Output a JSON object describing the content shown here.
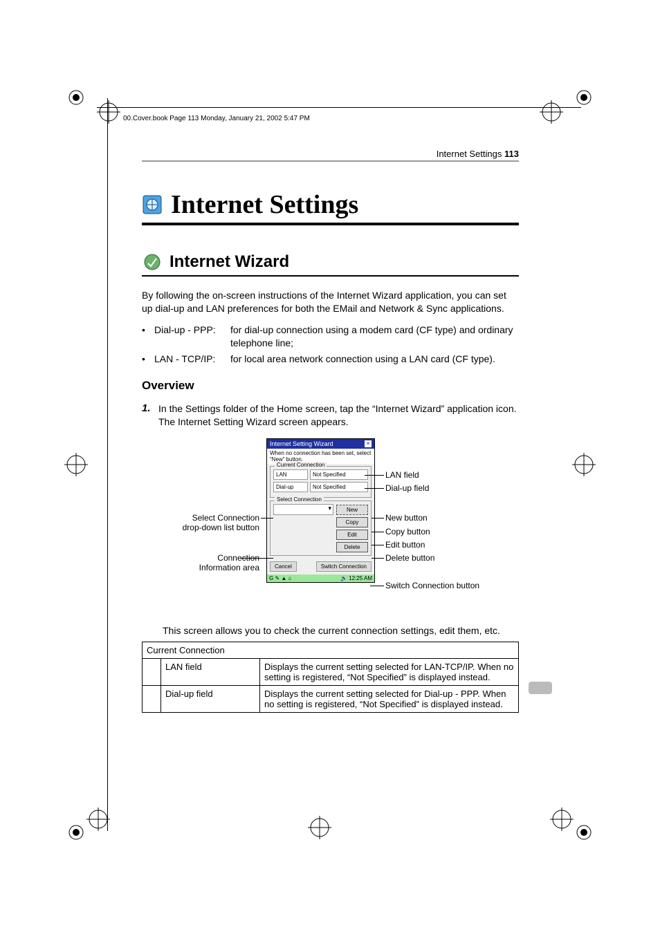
{
  "header_note": "00.Cover.book  Page 113  Monday, January 21, 2002  5:47 PM",
  "running": {
    "section": "Internet Settings",
    "page": "113"
  },
  "chapter_title": "Internet Settings",
  "section_title": "Internet Wizard",
  "intro": "By following the on-screen instructions of the Internet Wizard application, you can set up dial-up and LAN preferences for both the EMail and Network & Sync applications.",
  "bullets": [
    {
      "label": "Dial-up - PPP:",
      "desc": "for dial-up connection using a modem card (CF type) and ordinary telephone line;"
    },
    {
      "label": "LAN - TCP/IP:",
      "desc": "for local area network connection using a LAN card (CF type)."
    }
  ],
  "subhead": "Overview",
  "step1_num": "1.",
  "step1_a": "In the Settings folder of the Home screen, tap the “Internet Wizard” application icon.",
  "step1_b": "The Internet Setting Wizard screen appears.",
  "device": {
    "title": "Internet Setting Wizard",
    "tip": "When no connection has been set, select “New” button.",
    "legend_current": "Current Connection",
    "lan_label": "LAN",
    "lan_value": "Not Specified",
    "dialup_label": "Dial-up",
    "dialup_value": "Not Specified",
    "legend_select": "Select Connection",
    "btn_new": "New",
    "btn_copy": "Copy",
    "btn_edit": "Edit",
    "btn_delete": "Delete",
    "btn_cancel": "Cancel",
    "btn_switch": "Switch Connection",
    "task_time": "12:25 AM"
  },
  "callouts": {
    "left1": "Select Connection drop-down list button",
    "left2": "Connection Information area",
    "r_lan": "LAN field",
    "r_dialup": "Dial-up field",
    "r_new": "New button",
    "r_copy": "Copy button",
    "r_edit": "Edit button",
    "r_delete": "Delete button",
    "r_switch": "Switch Connection button"
  },
  "after_fig": "This screen allows you to check the current connection settings, edit them, etc.",
  "table": {
    "head": "Current Connection",
    "rows": [
      {
        "label": "LAN field",
        "desc": "Displays the current setting selected for LAN-TCP/IP. When no setting is registered, “Not Specified” is displayed instead."
      },
      {
        "label": "Dial-up field",
        "desc": "Displays the current setting selected for Dial-up - PPP. When no setting is registered, “Not Specified” is displayed instead."
      }
    ]
  }
}
